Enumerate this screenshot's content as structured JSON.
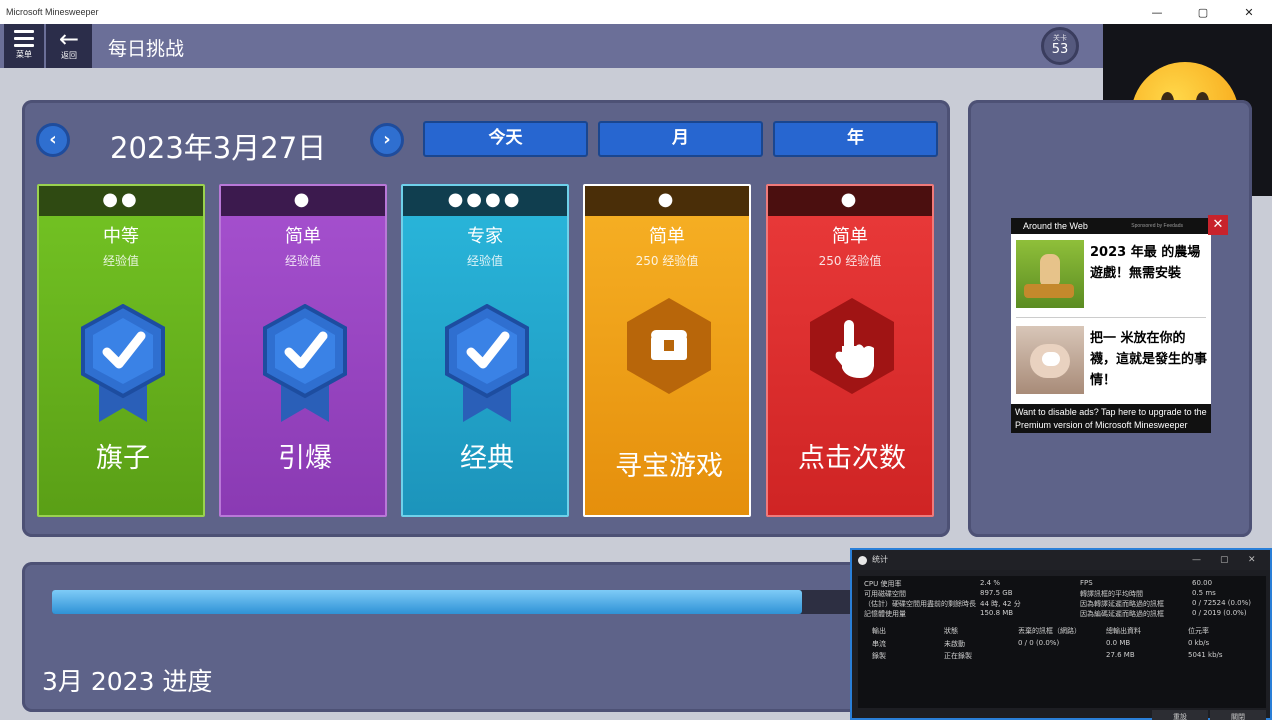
{
  "window": {
    "title": "Microsoft Minesweeper",
    "controls": [
      "—",
      "▢",
      "✕"
    ]
  },
  "header": {
    "menu_label": "菜单",
    "back_label": "返回",
    "page_title": "每日挑战",
    "level_label": "关卡",
    "level_number": "53"
  },
  "date_nav": {
    "prev_icon": "‹",
    "next_icon": "›",
    "date": "2023年3月27日",
    "periods": [
      "今天",
      "月",
      "年"
    ]
  },
  "cards": [
    {
      "dots": "●●",
      "difficulty": "中等",
      "xp": "经验值",
      "name": "旗子",
      "status": "completed",
      "color": "#6fba22"
    },
    {
      "dots": "●",
      "difficulty": "简单",
      "xp": "经验值",
      "name": "引爆",
      "status": "completed",
      "color": "#9b46c2"
    },
    {
      "dots": "●●●●",
      "difficulty": "专家",
      "xp": "经验值",
      "name": "经典",
      "status": "completed",
      "color": "#22a9cf"
    },
    {
      "dots": "●",
      "difficulty": "简单",
      "xp": "250 经验值",
      "name": "寻宝游戏",
      "status": "treasure",
      "color": "#f0a017"
    },
    {
      "dots": "●",
      "difficulty": "简单",
      "xp": "250 经验值",
      "name": "点击次数",
      "status": "tap",
      "color": "#dd3030"
    }
  ],
  "ad": {
    "heading": "Around the Web",
    "sponsor": "Sponsored by Feedads",
    "items": [
      {
        "text": "2023 年最 的農場遊戲！無需安裝"
      },
      {
        "text": "把一 米放在你的襪，這就是發生的事情！"
      }
    ],
    "footer": "Want to disable ads? Tap here to upgrade to the Premium version of Microsoft Minesweeper",
    "close_icon": "✕"
  },
  "progress": {
    "label": "3月 2023 进度",
    "fraction": 0.915
  },
  "stats_window": {
    "title": "统计",
    "rows_left": [
      [
        "CPU 使用率",
        "2.4 %"
      ],
      [
        "可用磁碟空間",
        "897.5 GB"
      ],
      [
        "（估計）硬碟空間用盡前的剩餘時長",
        "44 時, 42 分"
      ],
      [
        "記憶體使用量",
        "150.8 MB"
      ]
    ],
    "rows_right": [
      [
        "FPS",
        "60.00"
      ],
      [
        "轉譯訊框的平均時間",
        "0.5 ms"
      ],
      [
        "因為轉譯延遲而略過的訊框",
        "0 / 72524 (0.0%)"
      ],
      [
        "因為編碼延遲而略過的訊框",
        "0 / 2019 (0.0%)"
      ]
    ],
    "table_headers": [
      "輸出",
      "狀態",
      "丟棄的訊框（網路）",
      "總輸出資料",
      "位元率"
    ],
    "table_rows": [
      [
        "串流",
        "未啟動",
        "0 / 0 (0.0%)",
        "0.0 MB",
        "0 kb/s"
      ],
      [
        "錄製",
        "正在錄製",
        "",
        "27.6 MB",
        "5041 kb/s"
      ]
    ],
    "buttons": [
      "重設",
      "關閉"
    ]
  },
  "colors": {
    "accent_blue": "#2766d0",
    "panel": "#5e6389",
    "header": "#6b6f98"
  }
}
